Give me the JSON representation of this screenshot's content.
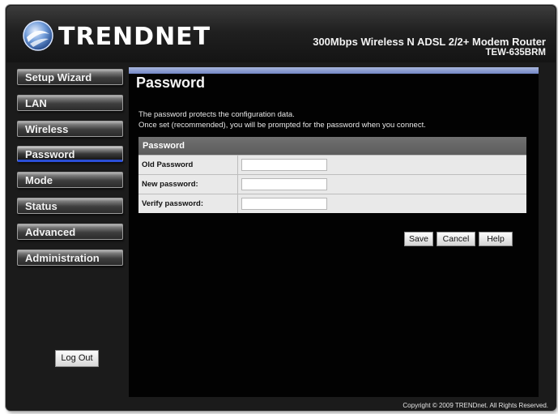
{
  "header": {
    "logo_text": "TRENDNET",
    "product_title": "300Mbps Wireless N ADSL 2/2+ Modem Router",
    "model": "TEW-635BRM"
  },
  "sidebar": {
    "items": [
      {
        "label": "Setup Wizard"
      },
      {
        "label": "LAN"
      },
      {
        "label": "Wireless"
      },
      {
        "label": "Password"
      },
      {
        "label": "Mode"
      },
      {
        "label": "Status"
      },
      {
        "label": "Advanced"
      },
      {
        "label": "Administration"
      }
    ],
    "logout_label": "Log Out"
  },
  "main": {
    "title": "Password",
    "description_line1": "The password protects the configuration data.",
    "description_line2": "Once set (recommended), you will be prompted for the password when you connect.",
    "table_header": "Password",
    "fields": [
      {
        "label": "Old Password",
        "value": ""
      },
      {
        "label": "New password:",
        "value": ""
      },
      {
        "label": "Verify password:",
        "value": ""
      }
    ],
    "buttons": {
      "save": "Save",
      "cancel": "Cancel",
      "help": "Help"
    }
  },
  "footer": {
    "copyright": "Copyright © 2009 TRENDnet. All Rights Reserved."
  },
  "colors": {
    "active_underline": "#2b4fd6",
    "content_bg": "#020202",
    "topbar": "#8b9bd0"
  }
}
